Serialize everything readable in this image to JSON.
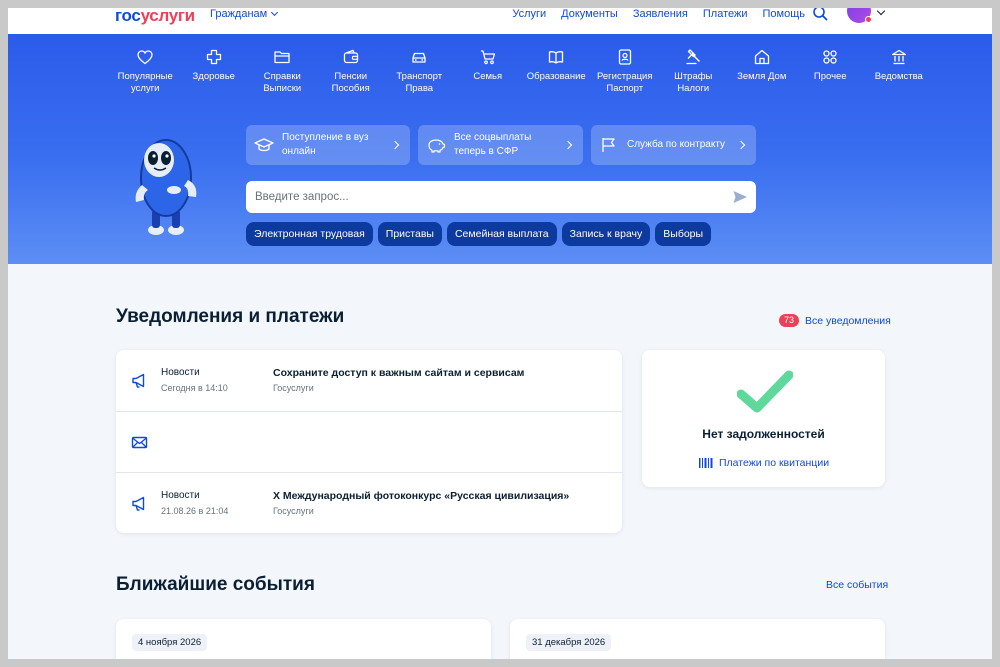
{
  "header": {
    "logo_part1": "гос",
    "logo_part2": "услуги",
    "audience": "Гражданам",
    "nav": [
      "Услуги",
      "Документы",
      "Заявления",
      "Платежи",
      "Помощь"
    ]
  },
  "categories": [
    {
      "line1": "Популярные",
      "line2": "услуги",
      "icon": "heart-icon"
    },
    {
      "line1": "Здоровье",
      "line2": "",
      "icon": "health-cross-icon"
    },
    {
      "line1": "Справки",
      "line2": "Выписки",
      "icon": "folder-icon"
    },
    {
      "line1": "Пенсии",
      "line2": "Пособия",
      "icon": "wallet-icon"
    },
    {
      "line1": "Транспорт",
      "line2": "Права",
      "icon": "car-icon"
    },
    {
      "line1": "Семья",
      "line2": "",
      "icon": "stroller-icon"
    },
    {
      "line1": "Образование",
      "line2": "",
      "icon": "book-icon"
    },
    {
      "line1": "Регистрация",
      "line2": "Паспорт",
      "icon": "passport-icon"
    },
    {
      "line1": "Штрафы",
      "line2": "Налоги",
      "icon": "gavel-icon"
    },
    {
      "line1": "Земля Дом",
      "line2": "",
      "icon": "house-icon"
    },
    {
      "line1": "Прочее",
      "line2": "",
      "icon": "grid-icon"
    },
    {
      "line1": "Ведомства",
      "line2": "",
      "icon": "building-icon"
    }
  ],
  "quick_links": [
    {
      "line1": "Поступление в вуз",
      "line2": "онлайн",
      "icon": "graduation-cap-icon"
    },
    {
      "line1": "Все соцвыплаты",
      "line2": "теперь в СФР",
      "icon": "piggy-bank-icon"
    },
    {
      "line1": "Служба по контракту",
      "line2": "",
      "icon": "flag-icon"
    }
  ],
  "search": {
    "placeholder": "Введите запрос..."
  },
  "chips": [
    "Электронная трудовая",
    "Приставы",
    "Семейная выплата",
    "Запись к врачу",
    "Выборы"
  ],
  "notifications": {
    "title": "Уведомления и платежи",
    "count": "73",
    "all_label": "Все уведомления",
    "items": [
      {
        "category": "Новости",
        "date": "Сегодня в 14:10",
        "headline": "Сохраните доступ к важным сайтам и сервисам",
        "source": "Госуслуги",
        "icon": "megaphone-icon"
      },
      {
        "category": "",
        "date": "",
        "headline": "",
        "source": "",
        "icon": "envelope-icon"
      },
      {
        "category": "Новости",
        "date": "21.08.26 в 21:04",
        "headline": "X Международный фотоконкурс «Русская цивилизация»",
        "source": "Госуслуги",
        "icon": "megaphone-icon"
      }
    ]
  },
  "debt": {
    "text": "Нет задолженностей",
    "link": "Платежи по квитанции"
  },
  "events": {
    "title": "Ближайшие события",
    "all_label": "Все события",
    "items": [
      {
        "date": "4 ноября 2026"
      },
      {
        "date": "31 декабря 2026"
      }
    ]
  },
  "colors": {
    "brand_blue": "#0d4cd3",
    "brand_red": "#ee3f58",
    "hero_blue": "#2b5bea",
    "chip_blue": "#0d3a9e",
    "check_green": "#5fd89b"
  }
}
